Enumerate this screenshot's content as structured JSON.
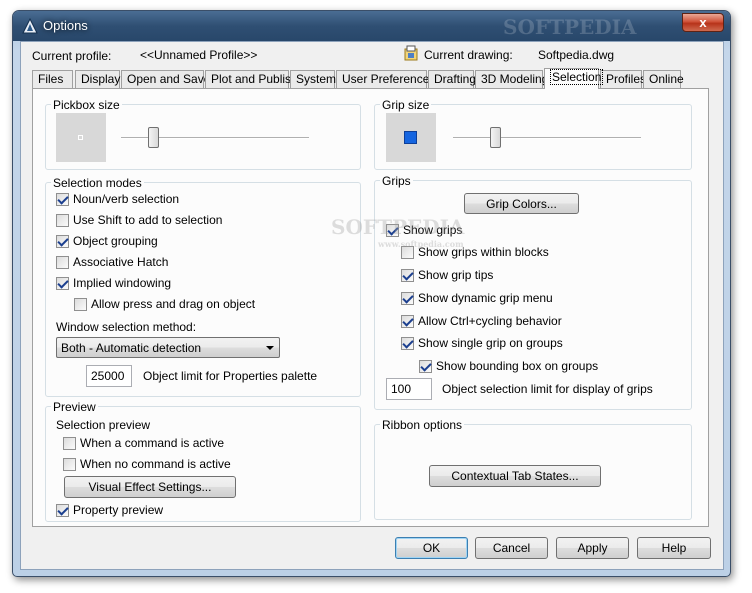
{
  "window": {
    "title": "Options",
    "close_glyph": "x"
  },
  "header": {
    "current_profile_label": "Current profile:",
    "current_profile_value": "<<Unnamed Profile>>",
    "current_drawing_label": "Current drawing:",
    "current_drawing_value": "Softpedia.dwg"
  },
  "tabs": [
    {
      "label": "Files"
    },
    {
      "label": "Display"
    },
    {
      "label": "Open and Save"
    },
    {
      "label": "Plot and Publish"
    },
    {
      "label": "System"
    },
    {
      "label": "User Preferences"
    },
    {
      "label": "Drafting"
    },
    {
      "label": "3D Modeling"
    },
    {
      "label": "Selection",
      "active": true
    },
    {
      "label": "Profiles"
    },
    {
      "label": "Online"
    }
  ],
  "pickbox": {
    "title": "Pickbox size",
    "slider_level": 0.18
  },
  "grip_size": {
    "title": "Grip size",
    "slider_level": 0.22,
    "grip_color": "#1565e0"
  },
  "selection_modes": {
    "title": "Selection modes",
    "items": [
      {
        "label": "Noun/verb selection",
        "checked": true
      },
      {
        "label": "Use Shift to add to selection",
        "checked": false
      },
      {
        "label": "Object grouping",
        "checked": true
      },
      {
        "label": "Associative Hatch",
        "checked": false
      },
      {
        "label": "Implied windowing",
        "checked": true
      },
      {
        "label": "Allow press and drag on object",
        "checked": false
      }
    ],
    "window_method_label": "Window selection method:",
    "window_method_value": "Both - Automatic detection",
    "object_limit_value": "25000",
    "object_limit_label": "Object limit for Properties palette"
  },
  "preview": {
    "title": "Preview",
    "selection_preview_label": "Selection preview",
    "items": [
      {
        "label": "When a command is active",
        "checked": false
      },
      {
        "label": "When no command is active",
        "checked": false
      }
    ],
    "visual_effect_button": "Visual Effect Settings...",
    "property_preview": {
      "label": "Property preview",
      "checked": true
    }
  },
  "grips": {
    "title": "Grips",
    "grip_colors_button": "Grip Colors...",
    "items": [
      {
        "label": "Show grips",
        "checked": true
      },
      {
        "label": "Show grips within blocks",
        "checked": false
      },
      {
        "label": "Show grip tips",
        "checked": true
      },
      {
        "label": "Show dynamic grip menu",
        "checked": true
      },
      {
        "label": "Allow Ctrl+cycling behavior",
        "checked": true
      },
      {
        "label": "Show single grip on groups",
        "checked": true
      },
      {
        "label": "Show bounding box on groups",
        "checked": true
      }
    ],
    "object_selection_limit_value": "100",
    "object_selection_limit_label": "Object selection limit for display of grips"
  },
  "ribbon": {
    "title": "Ribbon options",
    "contextual_button": "Contextual Tab States..."
  },
  "footer": {
    "ok": "OK",
    "cancel": "Cancel",
    "apply": "Apply",
    "help": "Help"
  },
  "watermark": {
    "title_text": "SOFTPEDIA",
    "center_text": "SOFTPEDIA",
    "center_sub": "www.softpedia.com"
  }
}
